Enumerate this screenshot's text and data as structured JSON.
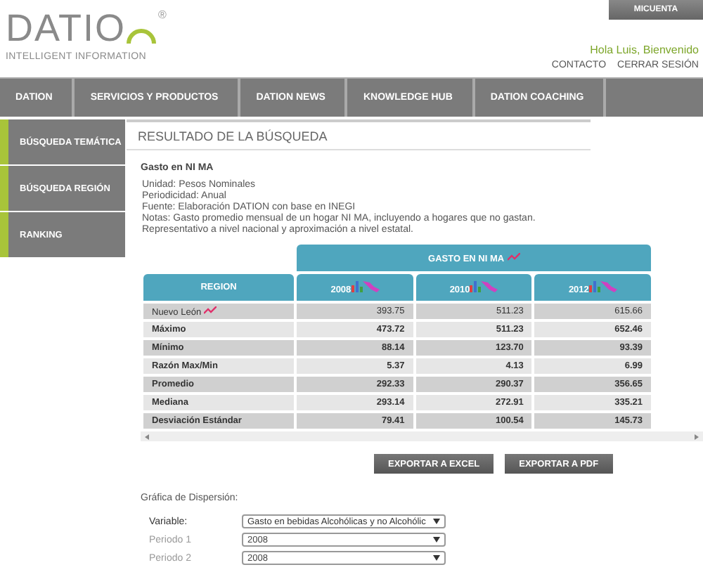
{
  "header": {
    "logo": "DATIO",
    "registered": "®",
    "tagline": "INTELLIGENT INFORMATION",
    "account_button": "MICUENTA",
    "greeting": "Hola Luis, Bienvenido",
    "links": [
      "CONTACTO",
      "CERRAR SESIÓN"
    ]
  },
  "nav": [
    "DATION",
    "SERVICIOS Y PRODUCTOS",
    "DATION NEWS",
    "KNOWLEDGE HUB",
    "DATION COACHING"
  ],
  "sidebar": {
    "items": [
      "BÚSQUEDA TEMÁTICA",
      "BÚSQUEDA REGIÓN",
      "RANKING"
    ]
  },
  "section_title": "RESULTADO DE LA BÚSQUEDA",
  "subject": "Gasto en NI MA",
  "info": [
    "Unidad: Pesos Nominales",
    "Periodicidad: Anual",
    "Fuente: Elaboración DATION con base en INEGI",
    "Notas:  Gasto promedio mensual de un hogar NI MA, incluyendo a hogares que no gastan. Representativo a nivel nacional y aproximación a nivel estatal."
  ],
  "table": {
    "group_header": "GASTO EN  NI MA",
    "columns": [
      "REGION",
      "2008",
      "2010",
      "2012"
    ],
    "rows": [
      {
        "kind": "region",
        "cells": [
          "Nuevo León",
          "393.75",
          "511.23",
          "615.66"
        ]
      },
      {
        "kind": "stat",
        "cells": [
          "Máximo",
          "473.72",
          "511.23",
          "652.46"
        ]
      },
      {
        "kind": "stat",
        "cells": [
          "Mínimo",
          "88.14",
          "123.70",
          "93.39"
        ]
      },
      {
        "kind": "stat",
        "cells": [
          "Razón Max/Min",
          "5.37",
          "4.13",
          "6.99"
        ]
      },
      {
        "kind": "stat",
        "cells": [
          "Promedio",
          "292.33",
          "290.37",
          "356.65"
        ]
      },
      {
        "kind": "stat",
        "cells": [
          "Mediana",
          "293.14",
          "272.91",
          "335.21"
        ]
      },
      {
        "kind": "stat",
        "cells": [
          "Desviación Estándar",
          "79.41",
          "100.54",
          "145.73"
        ]
      }
    ]
  },
  "buttons": [
    "EXPORTAR A EXCEL",
    "EXPORTAR A PDF"
  ],
  "scatter": {
    "title": "Gráfica de Dispersión:",
    "fields": [
      {
        "label": "Variable:",
        "value": "Gasto en bebidas Alcohólicas y no Alcohólic",
        "disabled": false
      },
      {
        "label": "Periodo 1",
        "value": "2008",
        "disabled": true
      },
      {
        "label": "Periodo 2",
        "value": "2008",
        "disabled": true
      }
    ]
  }
}
